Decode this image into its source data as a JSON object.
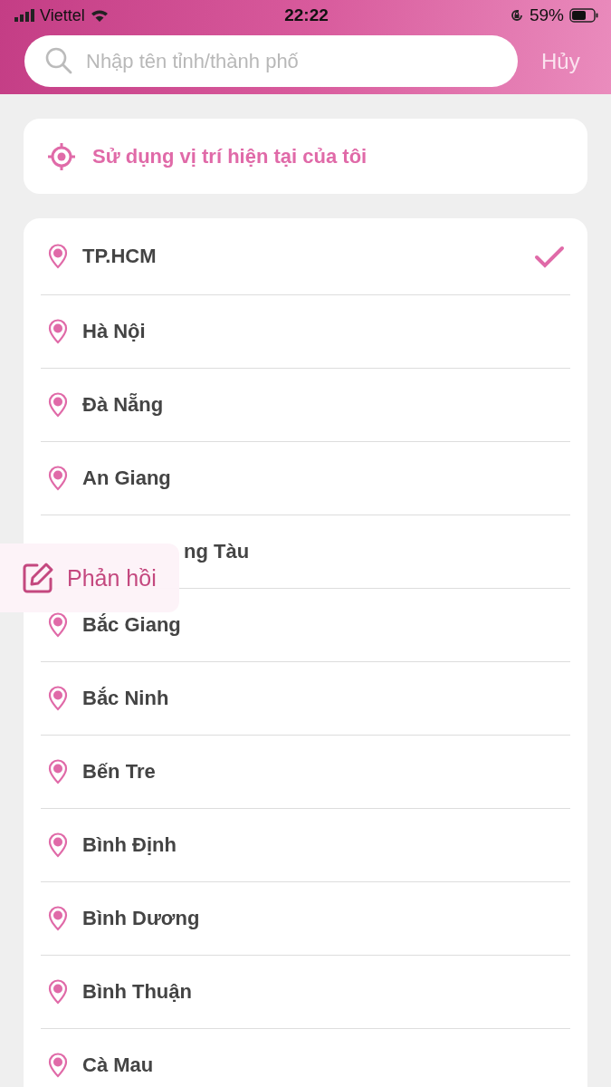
{
  "status_bar": {
    "carrier": "Viettel",
    "time": "22:22",
    "battery": "59%"
  },
  "search": {
    "placeholder": "Nhập tên tỉnh/thành phố",
    "cancel": "Hủy"
  },
  "current_location": {
    "label": "Sử dụng vị trí hiện tại của tôi"
  },
  "cities": [
    {
      "name": "TP.HCM",
      "selected": true,
      "kind": "row"
    },
    {
      "name": "Hà Nội",
      "selected": false,
      "kind": "row"
    },
    {
      "name": "Đà Nẵng",
      "selected": false,
      "kind": "row"
    },
    {
      "name": "An Giang",
      "selected": false,
      "kind": "row"
    },
    {
      "name": "ng Tàu",
      "selected": false,
      "kind": "covered"
    },
    {
      "name": "Bắc Giang",
      "selected": false,
      "kind": "row"
    },
    {
      "name": "Bắc Ninh",
      "selected": false,
      "kind": "row"
    },
    {
      "name": "Bến Tre",
      "selected": false,
      "kind": "row"
    },
    {
      "name": "Bình Định",
      "selected": false,
      "kind": "row"
    },
    {
      "name": "Bình Dương",
      "selected": false,
      "kind": "row"
    },
    {
      "name": "Bình Thuận",
      "selected": false,
      "kind": "row"
    },
    {
      "name": "Cà Mau",
      "selected": false,
      "kind": "row"
    }
  ],
  "feedback": {
    "label": "Phản hồi"
  }
}
